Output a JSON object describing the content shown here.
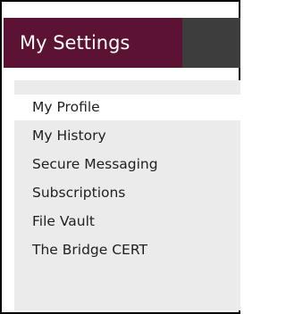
{
  "header": {
    "title": "My Settings"
  },
  "menu": {
    "items": [
      {
        "label": "My Profile",
        "active": true
      },
      {
        "label": "My History",
        "active": false
      },
      {
        "label": "Secure Messaging",
        "active": false
      },
      {
        "label": "Subscriptions",
        "active": false
      },
      {
        "label": "File Vault",
        "active": false
      },
      {
        "label": "The Bridge CERT",
        "active": false
      }
    ]
  },
  "colors": {
    "header_tab": "#5c1232",
    "header_bar": "#3d3d3d",
    "panel_background": "#ebebeb",
    "active_item_background": "#ffffff"
  }
}
